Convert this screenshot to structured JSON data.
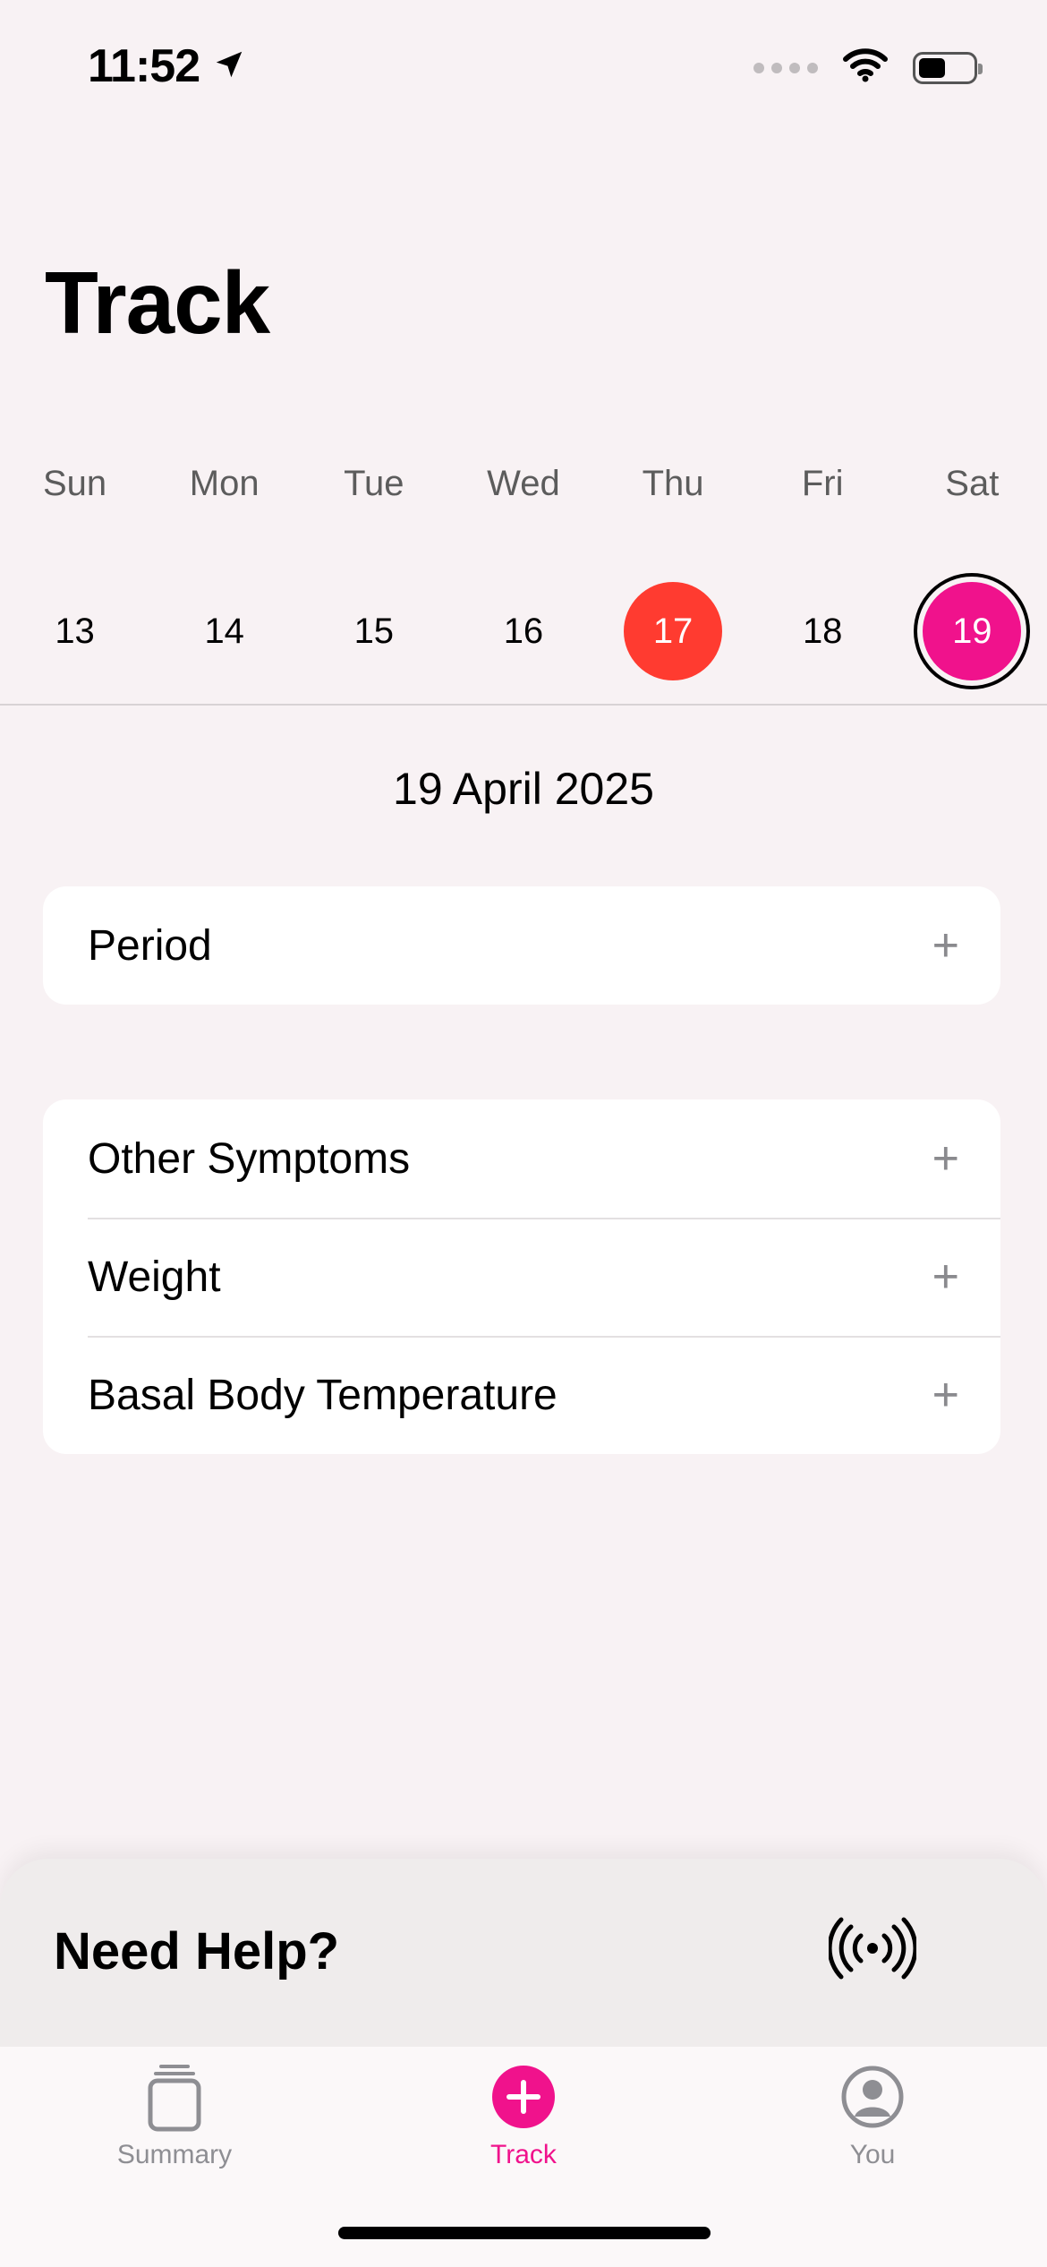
{
  "status_bar": {
    "time": "11:52",
    "battery_level": 0.5
  },
  "header": {
    "title": "Track"
  },
  "week": {
    "days": [
      {
        "dow": "Sun",
        "date": "13",
        "state": "normal"
      },
      {
        "dow": "Mon",
        "date": "14",
        "state": "normal"
      },
      {
        "dow": "Tue",
        "date": "15",
        "state": "normal"
      },
      {
        "dow": "Wed",
        "date": "16",
        "state": "normal"
      },
      {
        "dow": "Thu",
        "date": "17",
        "state": "today"
      },
      {
        "dow": "Fri",
        "date": "18",
        "state": "normal"
      },
      {
        "dow": "Sat",
        "date": "19",
        "state": "selected"
      }
    ]
  },
  "selected_date": "19 April 2025",
  "period_card": {
    "items": [
      {
        "label": "Period"
      }
    ]
  },
  "symptoms_card": {
    "items": [
      {
        "label": "Other Symptoms"
      },
      {
        "label": "Weight"
      },
      {
        "label": "Basal Body Temperature"
      }
    ]
  },
  "help": {
    "title": "Need Help?",
    "icon": "broadcast-icon"
  },
  "tab_bar": {
    "tabs": [
      {
        "label": "Summary",
        "icon": "summary-icon",
        "active": false
      },
      {
        "label": "Track",
        "icon": "track-plus-icon",
        "active": true
      },
      {
        "label": "You",
        "icon": "profile-icon",
        "active": false
      }
    ]
  },
  "colors": {
    "accent": "#f0128c",
    "today": "#ff3b30"
  }
}
